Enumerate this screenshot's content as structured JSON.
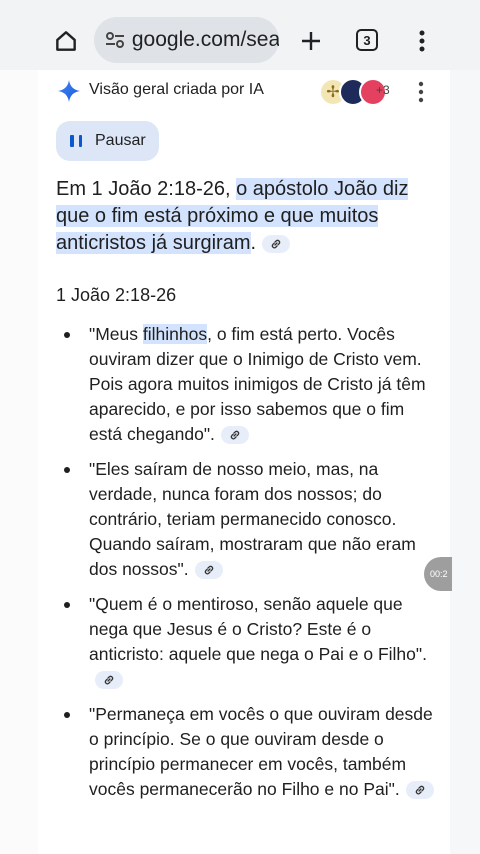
{
  "toolbar": {
    "url": "google.com/search",
    "tab_count": "3"
  },
  "ai_overview": {
    "title": "Visão geral criada por IA",
    "sources_more": "+3",
    "pause_label": "Pausar",
    "summary_prefix": "Em 1 João 2:18-26, ",
    "summary_highlight": "o apóstolo João diz que o fim está próximo e que muitos anticristos já surgiram",
    "summary_suffix": ".",
    "subheading": "1 João 2:18-26",
    "bullets": [
      {
        "pre": "\"Meus ",
        "highlight": "filhinhos",
        "post": ", o fim está perto. Vocês ouviram dizer que o Inimigo de Cristo vem. Pois agora muitos inimigos de Cristo já têm aparecido, e por isso sabemos que o fim está chegando\"."
      },
      {
        "text": "\"Eles saíram de nosso meio, mas, na verdade, nunca foram dos nossos; do contrário, teriam permanecido conosco. Quando saíram, mostraram que não eram dos nossos\"."
      },
      {
        "text": "\"Quem é o mentiroso, senão aquele que nega que Jesus é o Cristo? Este é o anticristo: aquele que nega o Pai e o Filho\"."
      },
      {
        "text": "\"Permaneça em vocês o que ouviram desde o princípio. Se o que ouviram desde o princípio permanecer em vocês, também vocês permanecerão no Filho e no Pai\"."
      }
    ]
  },
  "overlay": {
    "timer": "00:2"
  },
  "colors": {
    "highlight": "#d3e3fd",
    "accent": "#0b57d0",
    "toolbar_bg": "#f1f3f5"
  }
}
